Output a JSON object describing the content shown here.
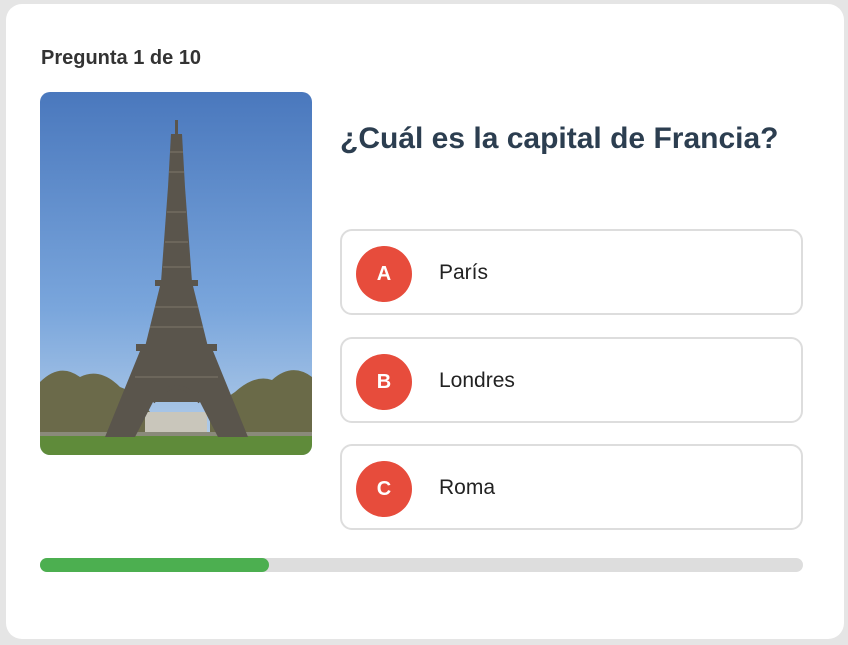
{
  "quiz": {
    "counter": "Pregunta 1 de 10",
    "question": "¿Cuál es la capital de Francia?",
    "image": "eiffel-tower-photo",
    "options": [
      {
        "letter": "A",
        "text": "París"
      },
      {
        "letter": "B",
        "text": "Londres"
      },
      {
        "letter": "C",
        "text": "Roma"
      }
    ],
    "progress": 0.3
  },
  "colors": {
    "accent": "#e74c3c",
    "progress": "#4caf50",
    "title": "#2c3e50"
  }
}
